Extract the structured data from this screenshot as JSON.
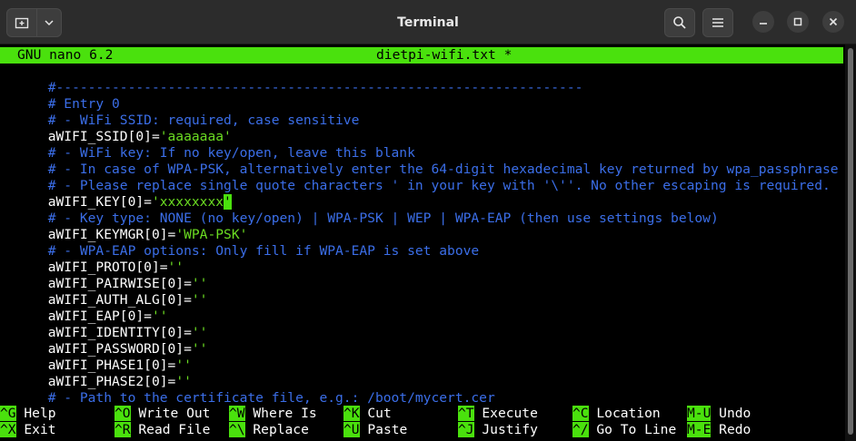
{
  "window": {
    "title": "Terminal"
  },
  "nano": {
    "app_version": "GNU nano 6.2",
    "filename": "dietpi-wifi.txt *"
  },
  "lines": [
    {
      "kind": "comment",
      "text": "#------------------------------------------------------------------"
    },
    {
      "kind": "comment",
      "text": "# Entry 0"
    },
    {
      "kind": "comment",
      "text": "# - WiFi SSID: required, case sensitive"
    },
    {
      "kind": "var",
      "name": "aWIFI_SSID[0]=",
      "value": "'aaaaaaa'"
    },
    {
      "kind": "comment",
      "text": "# - WiFi key: If no key/open, leave this blank"
    },
    {
      "kind": "comment",
      "text": "# - In case of WPA-PSK, alternatively enter the 64-digit hexadecimal key returned by wpa_passphrase"
    },
    {
      "kind": "comment",
      "text": "# - Please replace single quote characters ' in your key with '\\''. No other escaping is required."
    },
    {
      "kind": "var",
      "name": "aWIFI_KEY[0]=",
      "value": "'xxxxxxxx",
      "cursor": "'"
    },
    {
      "kind": "comment",
      "text": "# - Key type: NONE (no key/open) | WPA-PSK | WEP | WPA-EAP (then use settings below)"
    },
    {
      "kind": "var",
      "name": "aWIFI_KEYMGR[0]=",
      "value": "'WPA-PSK'"
    },
    {
      "kind": "comment",
      "text": "# - WPA-EAP options: Only fill if WPA-EAP is set above"
    },
    {
      "kind": "var",
      "name": "aWIFI_PROTO[0]=",
      "value": "''"
    },
    {
      "kind": "var",
      "name": "aWIFI_PAIRWISE[0]=",
      "value": "''"
    },
    {
      "kind": "var",
      "name": "aWIFI_AUTH_ALG[0]=",
      "value": "''"
    },
    {
      "kind": "var",
      "name": "aWIFI_EAP[0]=",
      "value": "''"
    },
    {
      "kind": "var",
      "name": "aWIFI_IDENTITY[0]=",
      "value": "''"
    },
    {
      "kind": "var",
      "name": "aWIFI_PASSWORD[0]=",
      "value": "''"
    },
    {
      "kind": "var",
      "name": "aWIFI_PHASE1[0]=",
      "value": "''"
    },
    {
      "kind": "var",
      "name": "aWIFI_PHASE2[0]=",
      "value": "''"
    },
    {
      "kind": "comment",
      "text": "# - Path to the certificate file, e.g.: /boot/mycert.cer"
    }
  ],
  "shortcuts": [
    [
      {
        "key": "^G",
        "label": "Help"
      },
      {
        "key": "^O",
        "label": "Write Out"
      },
      {
        "key": "^W",
        "label": "Where Is"
      },
      {
        "key": "^K",
        "label": "Cut"
      },
      {
        "key": "^T",
        "label": "Execute"
      },
      {
        "key": "^C",
        "label": "Location"
      },
      {
        "key": "M-U",
        "label": "Undo"
      }
    ],
    [
      {
        "key": "^X",
        "label": "Exit"
      },
      {
        "key": "^R",
        "label": "Read File"
      },
      {
        "key": "^\\",
        "label": "Replace"
      },
      {
        "key": "^U",
        "label": "Paste"
      },
      {
        "key": "^J",
        "label": "Justify"
      },
      {
        "key": "^/",
        "label": "Go To Line"
      },
      {
        "key": "M-E",
        "label": "Redo"
      }
    ]
  ],
  "icons": {
    "new_tab": "new-tab-icon",
    "tab_menu": "chevron-down-icon",
    "search": "search-icon",
    "menu": "hamburger-menu-icon",
    "minimize": "minimize-icon",
    "maximize": "maximize-icon",
    "close": "close-icon"
  },
  "colors": {
    "nano_bar": "#4ae10d",
    "comment": "#3b6ee8",
    "value": "#6bdc22",
    "titlebar": "#2c2c2c"
  }
}
